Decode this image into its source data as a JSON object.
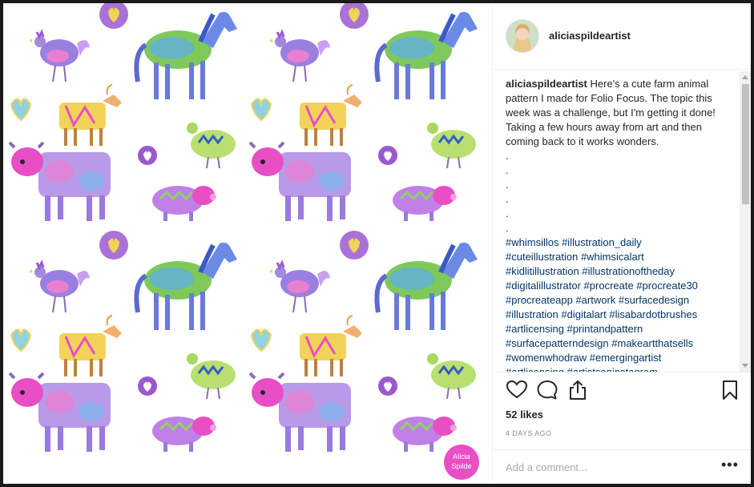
{
  "post": {
    "username": "aliciaspildeartist",
    "caption_text": "Here's a cute farm animal pattern I made for Folio Focus. The topic this week was a challenge, but I'm getting it done! Taking a few hours away from art and then coming back to it works wonders.",
    "dots": [
      ".",
      ".",
      ".",
      ".",
      ".",
      "."
    ],
    "hashtags": [
      "#whimsillos #illustration_daily",
      "#cuteillustration #whimsicalart",
      "#kidlitillustration #illustrationoftheday",
      "#digitalillustrator #procreate #procreate30",
      "#procreateapp #artwork #surfacedesign",
      "#illustration #digitalart #lisabardotbrushes",
      "#artlicensing #printandpattern",
      "#surfacepatterndesign #makeartthatsells",
      "#womenwhodraw #emergingartist",
      "#artlicensing #artistsoninstagram"
    ],
    "likes": "52 likes",
    "timestamp": "4 DAYS AGO",
    "comment_placeholder": "Add a comment...",
    "more_label": "•••"
  },
  "image": {
    "watermark_line1": "Alicia",
    "watermark_line2": "Spilde"
  },
  "icons": [
    "heart-icon",
    "comment-icon",
    "share-icon",
    "bookmark-icon",
    "more-options-icon"
  ],
  "colors": {
    "link": "#003569",
    "muted": "#8e8e8e",
    "border": "#efefef",
    "pattern_purple": "#9b59d0",
    "pattern_pink": "#e84fc4",
    "pattern_green": "#8fd36a",
    "pattern_blue": "#5a8fe0",
    "pattern_yellow": "#f2d35a"
  }
}
